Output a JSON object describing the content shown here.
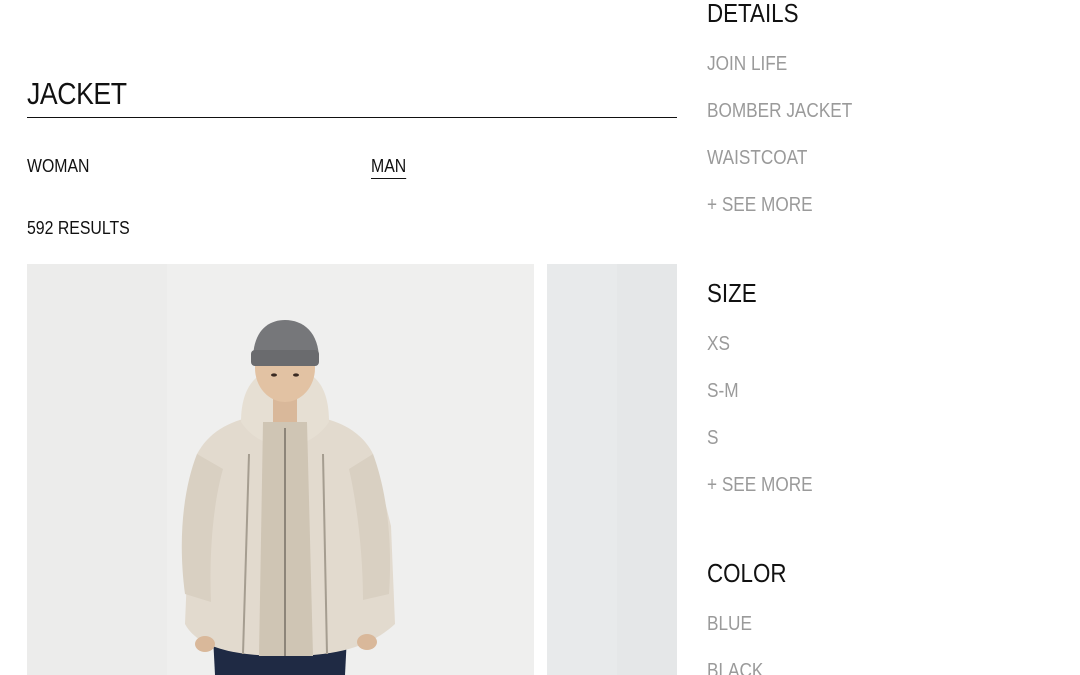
{
  "search": {
    "value": "JACKET"
  },
  "gender_tabs": [
    {
      "label": "WOMAN",
      "selected": false
    },
    {
      "label": "MAN",
      "selected": true
    }
  ],
  "results": {
    "count_label": "592 RESULTS"
  },
  "filters": {
    "details": {
      "title": "DETAILS",
      "options": [
        "JOIN LIFE",
        "BOMBER JACKET",
        "WAISTCOAT"
      ],
      "see_more": "+ SEE MORE"
    },
    "size": {
      "title": "SIZE",
      "options": [
        "XS",
        "S-M",
        "S"
      ],
      "see_more": "+ SEE MORE"
    },
    "color": {
      "title": "COLOR",
      "options": [
        "BLUE",
        "BLACK"
      ]
    }
  },
  "colors": {
    "text_primary": "#111111",
    "text_muted": "#9a9a9a",
    "background": "#ffffff"
  }
}
